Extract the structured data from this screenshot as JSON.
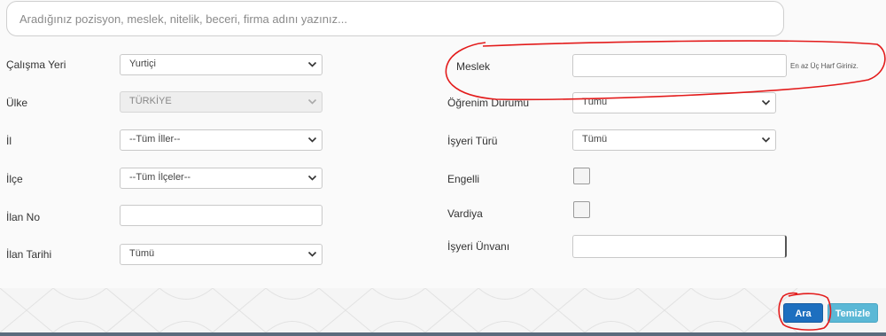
{
  "search": {
    "placeholder": "Aradığınız pozisyon, meslek, nitelik, beceri, firma adını yazınız..."
  },
  "left_fields": {
    "calisma_yeri": {
      "label": "Çalışma Yeri",
      "value": "Yurtiçi"
    },
    "ulke": {
      "label": "Ülke",
      "value": "TÜRKİYE"
    },
    "il": {
      "label": "İl",
      "value": "--Tüm İller--"
    },
    "ilce": {
      "label": "İlçe",
      "value": "--Tüm İlçeler--"
    },
    "ilan_no": {
      "label": "İlan No",
      "value": ""
    },
    "ilan_tarihi": {
      "label": "İlan Tarihi",
      "value": "Tümü"
    }
  },
  "right_fields": {
    "meslek": {
      "label": "Meslek",
      "value": "",
      "hint": "En az Üç Harf Giriniz."
    },
    "ogrenim_durumu": {
      "label": "Öğrenim Durumu",
      "value": "Tümü"
    },
    "isyeri_turu": {
      "label": "İşyeri Türü",
      "value": "Tümü"
    },
    "engelli": {
      "label": "Engelli",
      "checked": false
    },
    "vardiya": {
      "label": "Vardiya",
      "checked": false
    },
    "isyeri_unvani": {
      "label": "İşyeri Ünvanı",
      "value": ""
    }
  },
  "buttons": {
    "search": "Ara",
    "clear": "Temizle"
  },
  "colors": {
    "primary": "#1d6fbf",
    "info": "#5bb8d6",
    "annotation": "#e31b1b"
  },
  "icons": {
    "dropdown": "chevron-down-icon"
  }
}
